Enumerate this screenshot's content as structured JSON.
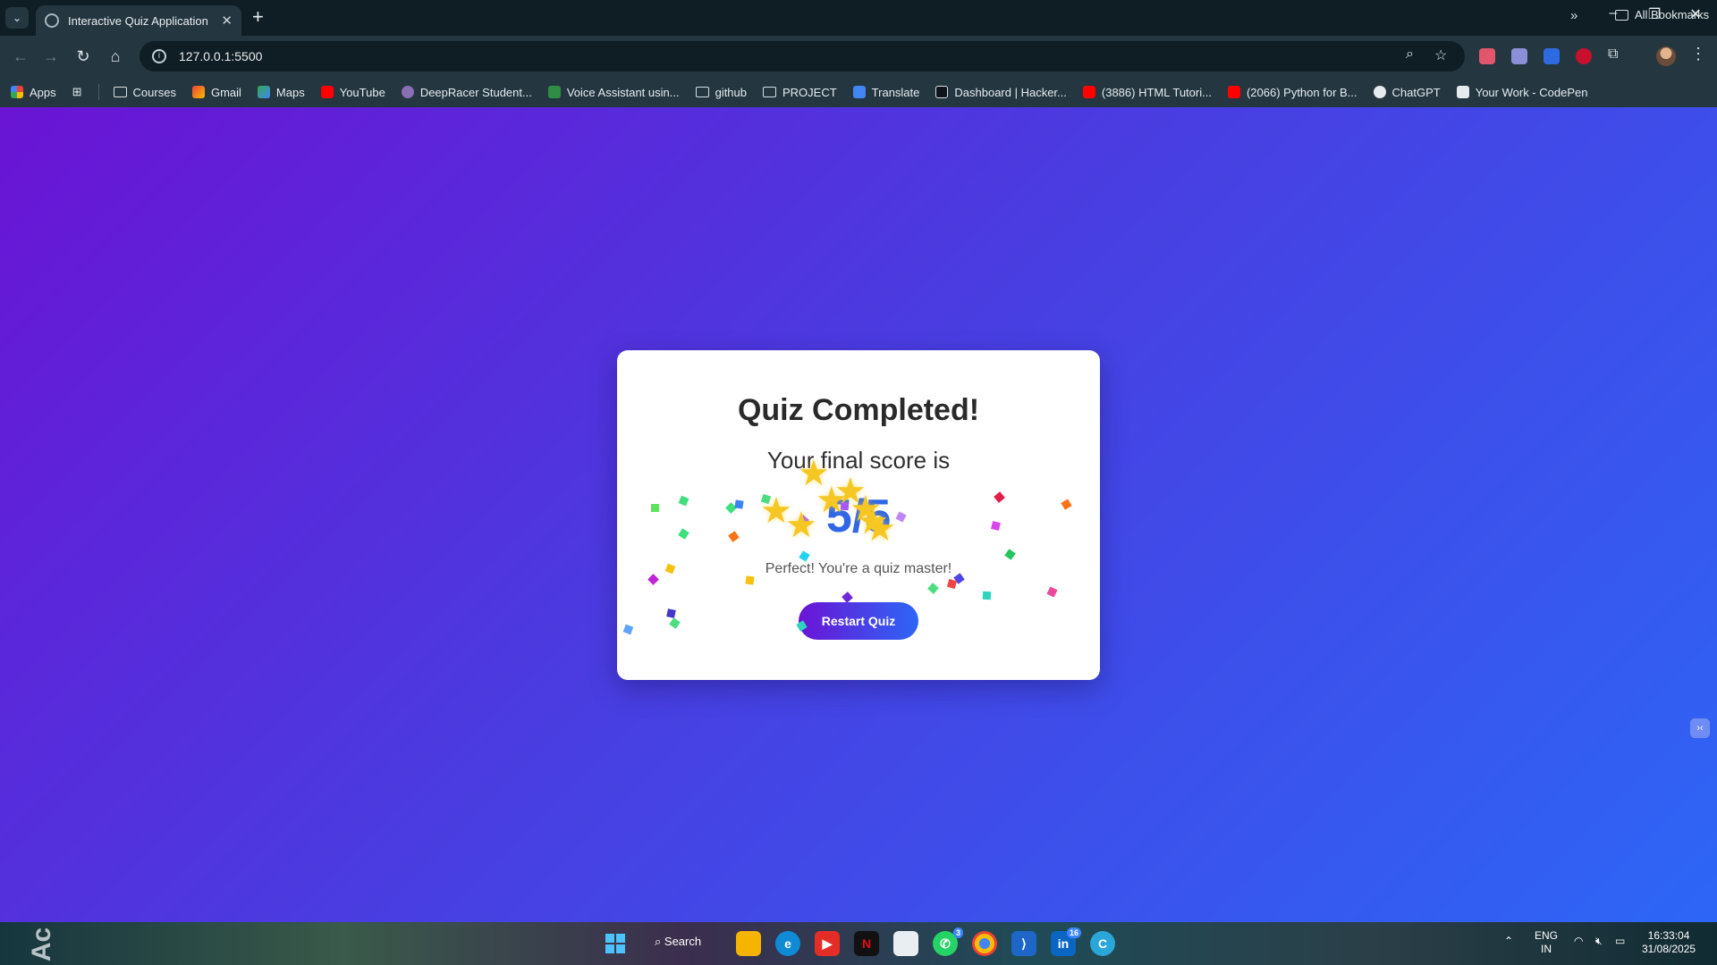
{
  "tab": {
    "title": "Interactive Quiz Application",
    "close": "✕"
  },
  "window": {
    "minimize": "–",
    "restore": "❐",
    "close": "✕",
    "new_tab": "+"
  },
  "address": {
    "url": "127.0.0.1:5500"
  },
  "bookmarks": [
    {
      "label": "Apps",
      "kind": "apps"
    },
    {
      "label": "Courses",
      "kind": "folder"
    },
    {
      "label": "Gmail",
      "kind": "gmail"
    },
    {
      "label": "Maps",
      "kind": "maps"
    },
    {
      "label": "YouTube",
      "kind": "youtube"
    },
    {
      "label": "DeepRacer Student...",
      "kind": "site"
    },
    {
      "label": "Voice Assistant usin...",
      "kind": "gfg"
    },
    {
      "label": "github",
      "kind": "folder"
    },
    {
      "label": "PROJECT",
      "kind": "folder"
    },
    {
      "label": "Translate",
      "kind": "translate"
    },
    {
      "label": "Dashboard | Hacker...",
      "kind": "hackerrank"
    },
    {
      "label": "(3886) HTML Tutori...",
      "kind": "youtube"
    },
    {
      "label": "(2066) Python for B...",
      "kind": "youtube"
    },
    {
      "label": "ChatGPT",
      "kind": "chatgpt"
    },
    {
      "label": "Your Work - CodePen",
      "kind": "codepen"
    }
  ],
  "all_bookmarks": "All Bookmarks",
  "quiz": {
    "heading": "Quiz Completed!",
    "subtitle": "Your final score is",
    "score": "5/5",
    "message": "Perfect! You're a quiz master!",
    "restart_label": "Restart Quiz"
  },
  "taskbar": {
    "search_label": "Search",
    "left_text": "Ac",
    "whatsapp_badge": "3",
    "linkedin_badge": "16",
    "language": "ENG",
    "region": "IN",
    "time": "16:33:04",
    "date": "31/08/2025"
  },
  "colors": {
    "accent_start": "#6a14d4",
    "accent_end": "#2d66f6",
    "score": "#2f67e6"
  }
}
